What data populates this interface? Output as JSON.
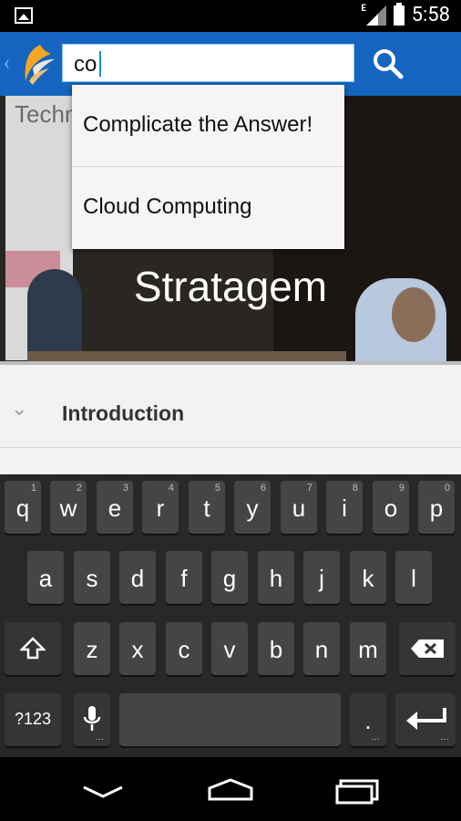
{
  "status_bar": {
    "time": "5:58",
    "network_type": "E",
    "icons": [
      "gallery-icon",
      "signal-icon",
      "battery-icon"
    ]
  },
  "app_bar": {
    "search_value": "co",
    "icons": [
      "back-chevron-icon",
      "app-logo-icon",
      "search-icon"
    ],
    "color": "#1565c0"
  },
  "suggestions": [
    {
      "label": "Complicate the Answer!"
    },
    {
      "label": "Cloud Computing"
    }
  ],
  "hero": {
    "title": "Stratagem",
    "banner_text": "Techni"
  },
  "content": {
    "section": {
      "label": "Introduction",
      "icon": "chevron-down-icon"
    }
  },
  "keyboard": {
    "row1": [
      {
        "ch": "q",
        "sup": "1"
      },
      {
        "ch": "w",
        "sup": "2"
      },
      {
        "ch": "e",
        "sup": "3"
      },
      {
        "ch": "r",
        "sup": "4"
      },
      {
        "ch": "t",
        "sup": "5"
      },
      {
        "ch": "y",
        "sup": "6"
      },
      {
        "ch": "u",
        "sup": "7"
      },
      {
        "ch": "i",
        "sup": "8"
      },
      {
        "ch": "o",
        "sup": "9"
      },
      {
        "ch": "p",
        "sup": "0"
      }
    ],
    "row2": [
      "a",
      "s",
      "d",
      "f",
      "g",
      "h",
      "j",
      "k",
      "l"
    ],
    "row3": [
      "z",
      "x",
      "c",
      "v",
      "b",
      "n",
      "m"
    ],
    "symbols_label": "?123",
    "period_label": ".",
    "special_keys": [
      "shift-icon",
      "backspace-icon",
      "mic-icon",
      "enter-icon"
    ]
  },
  "nav_bar": {
    "icons": [
      "back-icon",
      "home-icon",
      "recents-icon"
    ]
  }
}
